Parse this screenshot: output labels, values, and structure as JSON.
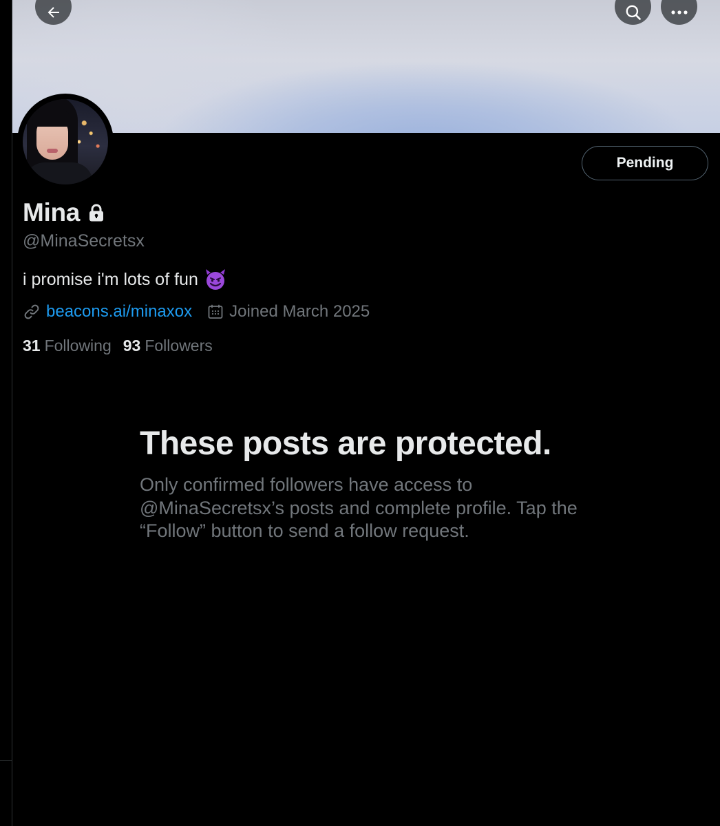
{
  "header": {
    "back_icon": "arrow-left-icon",
    "search_icon": "search-icon",
    "more_icon": "more-horizontal-icon"
  },
  "profile": {
    "display_name": "Mina",
    "protected_icon": "lock-icon",
    "handle": "@MinaSecretsx",
    "bio_text": "i promise i'm lots of fun",
    "bio_emoji_icon": "smiling-devil-emoji-icon",
    "link_icon": "link-icon",
    "link_text": "beacons.ai/minaxox",
    "calendar_icon": "calendar-icon",
    "joined_text": "Joined March 2025",
    "following_count": "31",
    "following_label": "Following",
    "followers_count": "93",
    "followers_label": "Followers",
    "action_button_label": "Pending"
  },
  "protected_notice": {
    "title": "These posts are protected.",
    "body": "Only confirmed followers have access to @MinaSecretsx’s posts and complete profile. Tap the “Follow” button to send a follow request."
  },
  "colors": {
    "background": "#000000",
    "primary_text": "#e7e9ea",
    "secondary_text": "#71767b",
    "link": "#1d9bf0",
    "button_border": "#536471"
  }
}
